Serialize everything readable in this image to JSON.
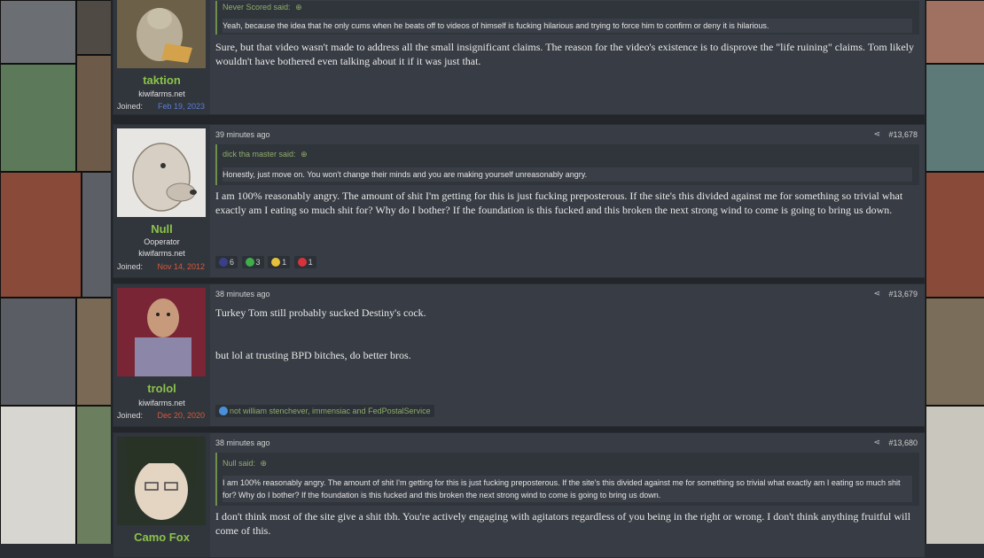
{
  "posts": [
    {
      "username": "taktion",
      "site": "kiwifarms.net",
      "joined_label": "Joined:",
      "joined_date": "Feb 19, 2023",
      "quote_author": "Never Scored said:",
      "quote_text": "Yeah, because the idea that he only cums when he beats off to videos of himself is fucking hilarious and trying to force him to confirm or deny it is hilarious.",
      "body": "Sure, but that video wasn't made to address all the small insignificant claims. The reason for the video's existence is to disprove the \"life ruining\" claims. Tom likely wouldn't have bothered even talking about it if it was just that."
    },
    {
      "username": "Null",
      "user_title": "Ooperator",
      "site": "kiwifarms.net",
      "joined_label": "Joined:",
      "joined_date": "Nov 14, 2012",
      "time": "39 minutes ago",
      "post_number": "#13,678",
      "quote_author": "dick tha master said:",
      "quote_text": "Honestly, just move on. You won't change their minds and you are making yourself unreasonably angry.",
      "body": "I am 100% reasonably angry. The amount of shit I'm getting for this is just fucking preposterous. If the site's this divided against me for something so trivial what exactly am I eating so much shit for? Why do I bother? If the foundation is this fucked and this broken the next strong wind to come is going to bring us down.",
      "reactions": [
        "6",
        "3",
        "1",
        "1"
      ]
    },
    {
      "username": "trolol",
      "site": "kiwifarms.net",
      "joined_label": "Joined:",
      "joined_date": "Dec 20, 2020",
      "time": "38 minutes ago",
      "post_number": "#13,679",
      "body_line1": "Turkey Tom still probably sucked Destiny's cock.",
      "body_line2": "but lol at trusting BPD bitches, do better bros.",
      "reaction_users": "not william stenchever, immensiac and FedPostalService"
    },
    {
      "username": "Camo Fox",
      "time": "38 minutes ago",
      "post_number": "#13,680",
      "quote_author": "Null said:",
      "quote_text": "I am 100% reasonably angry. The amount of shit I'm getting for this is just fucking preposterous. If the site's this divided against me for something so trivial what exactly am I eating so much shit for? Why do I bother? If the foundation is this fucked and this broken the next strong wind to come is going to bring us down.",
      "body": "I don't think most of the site give a shit tbh. You're actively engaging with agitators regardless of you being in the right or wrong. I don't think anything fruitful will come of this."
    }
  ],
  "colors": {
    "username": "#8bc34a",
    "joined_date_1": "#5a7fd6",
    "joined_date_2": "#d65a3a",
    "joined_date_3": "#d65a3a",
    "quote_border": "#6e8f4a"
  },
  "icons": [
    "share-icon",
    "quote-arrow-icon",
    "reaction-icon"
  ]
}
